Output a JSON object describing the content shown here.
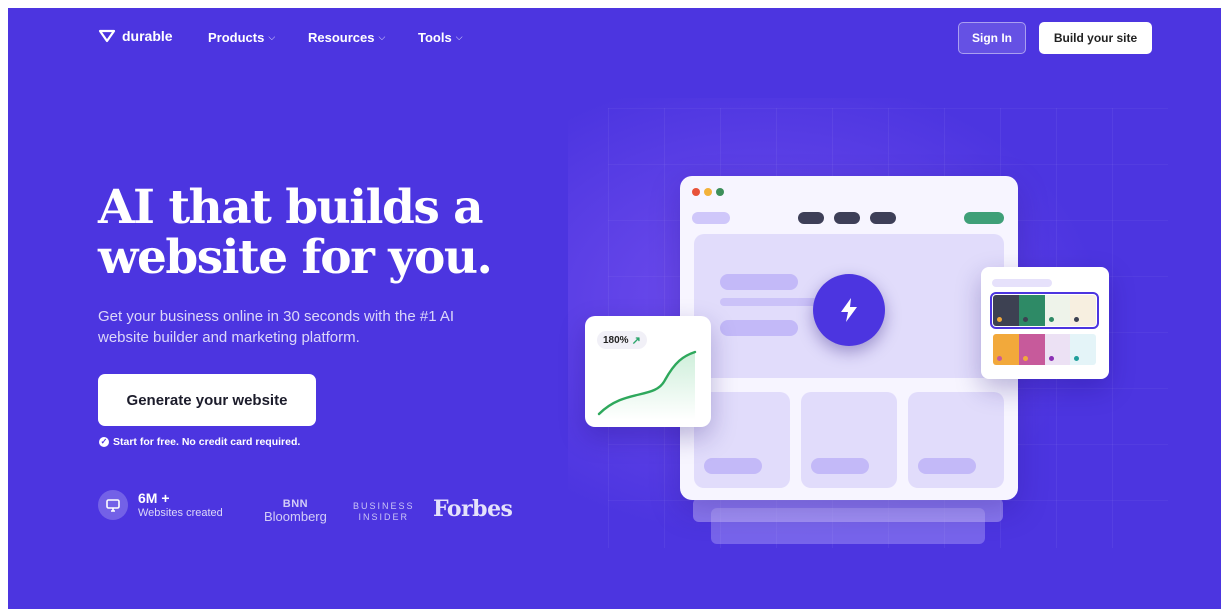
{
  "nav": {
    "logo_text": "durable",
    "items": [
      {
        "label": "Products"
      },
      {
        "label": "Resources"
      },
      {
        "label": "Tools"
      }
    ],
    "sign_in": "Sign In",
    "build_site": "Build your site"
  },
  "hero": {
    "title_line1": "AI that builds a",
    "title_line2": "website for you.",
    "subtitle_line1": "Get your business online in 30 seconds with the #1 AI",
    "subtitle_line2": "website builder and marketing platform.",
    "cta": "Generate your website",
    "note": "Start for free. No credit card required."
  },
  "stats": {
    "count": "6M +",
    "label": "Websites created"
  },
  "press": {
    "bnn_top": "BNN",
    "bnn_bottom": "Bloomberg",
    "bi_top": "BUSINESS",
    "bi_bottom": "INSIDER",
    "forbes": "Forbes"
  },
  "illustration": {
    "growth_value": "180%",
    "colors": {
      "brand": "#4c35e0",
      "accent_green": "#3f9f78",
      "swatch_row1": [
        "#3d4152",
        "#2e8a66",
        "#eef3ea",
        "#f7efe0"
      ],
      "swatch_row2": [
        "#f2a93b",
        "#c75a9b",
        "#ece1f4",
        "#e4f4f8"
      ]
    }
  }
}
